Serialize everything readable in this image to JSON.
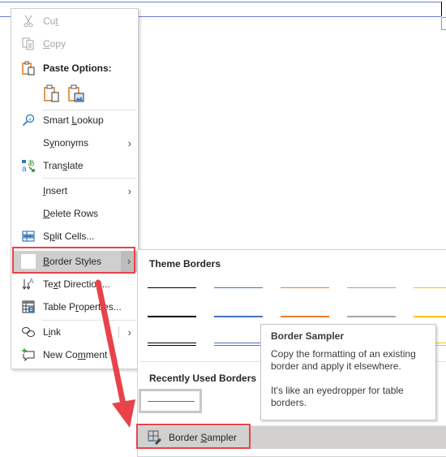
{
  "context_menu": {
    "items": [
      {
        "id": "cut",
        "label": "Cut",
        "mnemonic": "t",
        "disabled": true,
        "icon": "scissors-icon"
      },
      {
        "id": "copy",
        "label": "Copy",
        "mnemonic": "C",
        "disabled": true,
        "icon": "copy-icon"
      },
      {
        "id": "paste-options",
        "label": "Paste Options:",
        "icon": "clipboard-icon"
      },
      {
        "id": "smart-lookup",
        "label": "Smart Lookup",
        "mnemonic": "L",
        "icon": "smart-lookup-icon"
      },
      {
        "id": "synonyms",
        "label": "Synonyms",
        "mnemonic": "y",
        "submenu": true
      },
      {
        "id": "translate",
        "label": "Translate",
        "mnemonic": "s",
        "icon": "translate-icon"
      },
      {
        "id": "insert",
        "label": "Insert",
        "mnemonic": "I",
        "submenu": true
      },
      {
        "id": "delete-rows",
        "label": "Delete Rows",
        "mnemonic": "D"
      },
      {
        "id": "split-cells",
        "label": "Split Cells...",
        "mnemonic": "p",
        "icon": "split-cells-icon"
      },
      {
        "id": "border-styles",
        "label": "Border Styles",
        "mnemonic": "B",
        "submenu": true,
        "highlighted": true
      },
      {
        "id": "text-direction",
        "label": "Text Direction...",
        "mnemonic": "x",
        "icon": "text-direction-icon"
      },
      {
        "id": "table-properties",
        "label": "Table Properties...",
        "mnemonic": "r",
        "icon": "table-properties-icon"
      },
      {
        "id": "link",
        "label": "Link",
        "mnemonic": "i",
        "submenu": true,
        "icon": "link-icon"
      },
      {
        "id": "new-comment",
        "label": "New Comment",
        "mnemonic": "m",
        "icon": "new-comment-icon"
      }
    ],
    "paste_buttons": [
      "keep-source-formatting-icon",
      "picture-paste-icon"
    ]
  },
  "submenu": {
    "theme_borders_title": "Theme Borders",
    "theme_borders": {
      "colors": [
        "#000000",
        "#4472c4",
        "#ed7d31",
        "#a5a5a5",
        "#ffc000"
      ],
      "styles": [
        "thin",
        "thick",
        "double"
      ]
    },
    "recent_title": "Recently Used Borders",
    "recent_color": "#4472c4",
    "sampler_label": "Border Sampler",
    "sampler_mnemonic": "S"
  },
  "tooltip": {
    "title": "Border Sampler",
    "line1": "Copy the formatting of an existing border and apply it elsewhere.",
    "line2": "It's like an eyedropper for table borders."
  },
  "annotation": {
    "color": "#e8434a"
  }
}
